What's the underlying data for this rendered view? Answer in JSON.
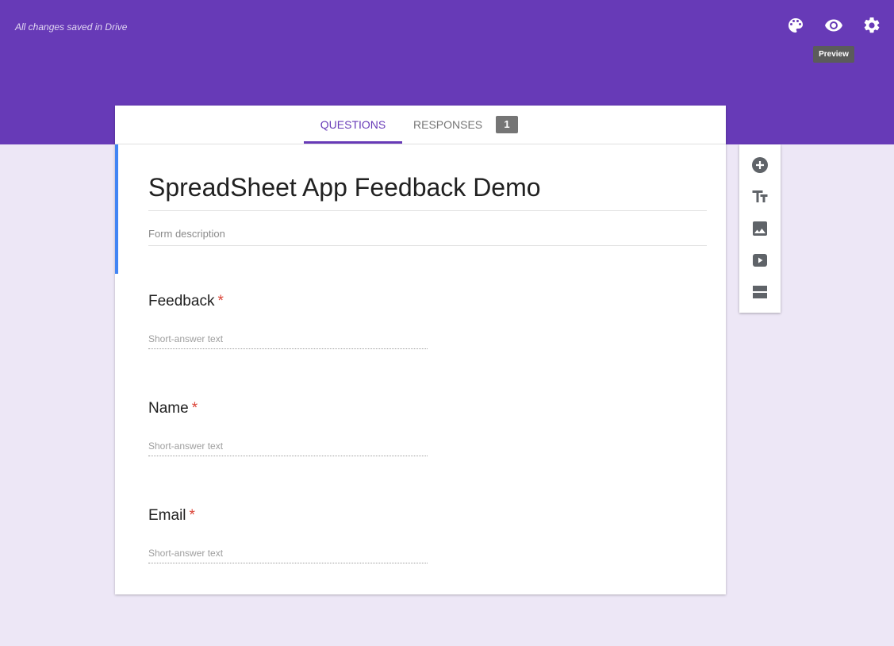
{
  "header": {
    "save_status": "All changes saved in Drive",
    "icons": [
      "palette-icon",
      "eye-icon",
      "gear-icon"
    ],
    "tooltip": "Preview"
  },
  "tabs": {
    "questions_label": "QUESTIONS",
    "responses_label": "RESPONSES",
    "responses_count": "1"
  },
  "form": {
    "title": "SpreadSheet App Feedback Demo",
    "description_placeholder": "Form description",
    "questions": [
      {
        "title": "Feedback",
        "required_mark": "*",
        "answer_placeholder": "Short-answer text"
      },
      {
        "title": "Name",
        "required_mark": "*",
        "answer_placeholder": "Short-answer text"
      },
      {
        "title": "Email",
        "required_mark": "*",
        "answer_placeholder": "Short-answer text"
      }
    ]
  },
  "toolbar": {
    "icons": [
      "add-question-icon",
      "add-title-icon",
      "add-image-icon",
      "add-video-icon",
      "add-section-icon"
    ]
  },
  "colors": {
    "header_purple": "#673ab7",
    "background_lavender": "#ede7f6",
    "title_accent_blue": "#4285f4",
    "required_red": "#db4437"
  }
}
